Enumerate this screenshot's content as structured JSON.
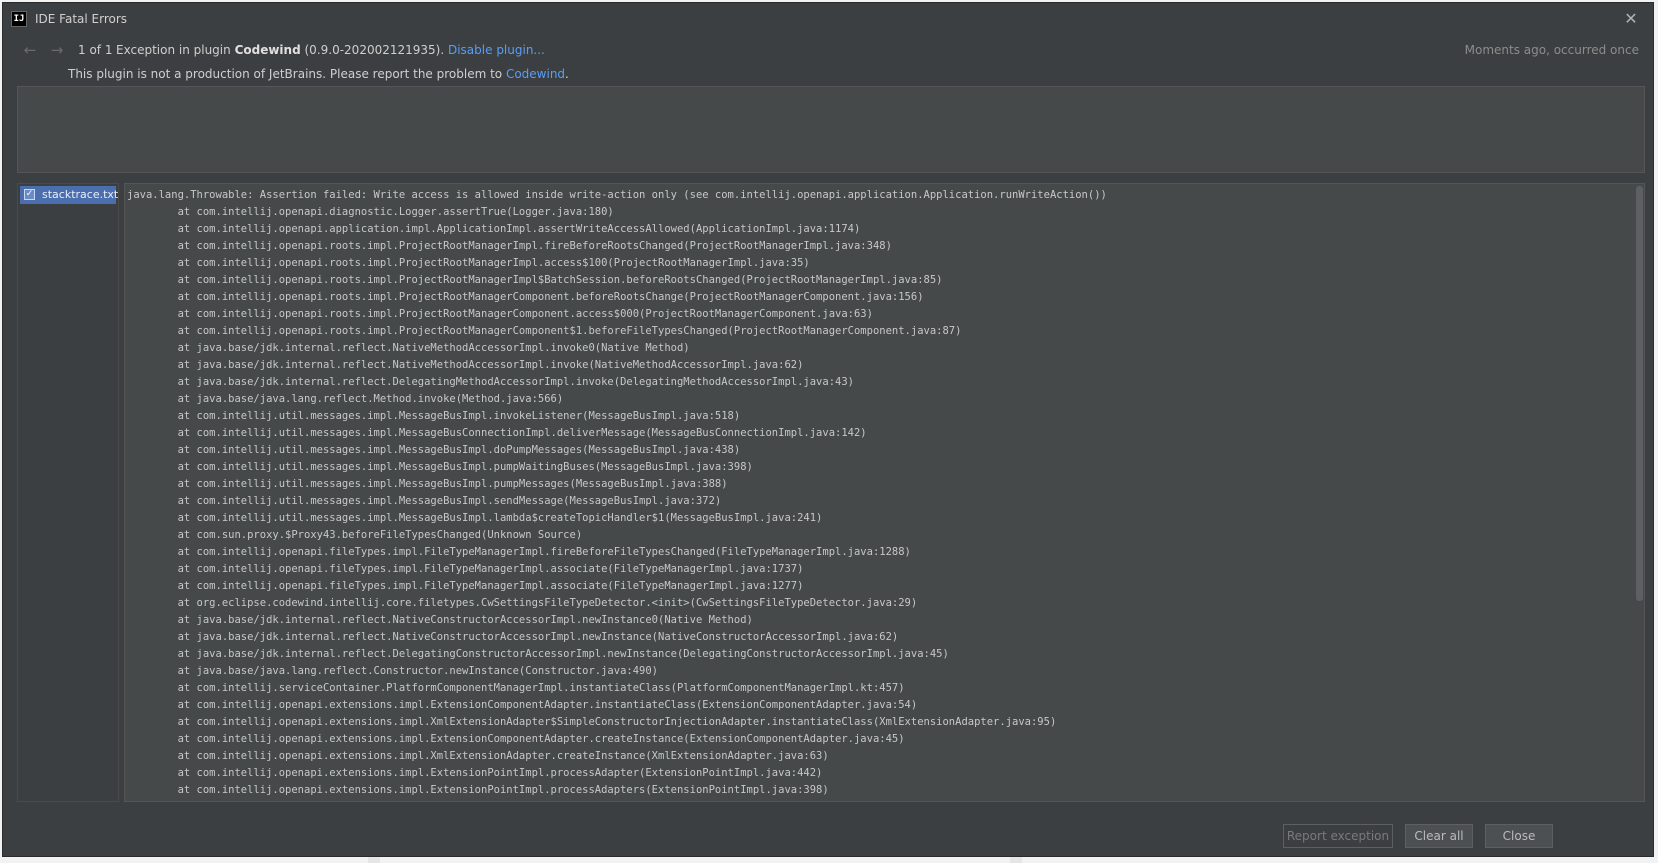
{
  "window": {
    "title": "IDE Fatal Errors",
    "logo_text": "IJ"
  },
  "header": {
    "counter": "1 of 1",
    "exception_prefix": "Exception in plugin ",
    "plugin_name": "Codewind",
    "plugin_version": " (0.9.0-202002121935). ",
    "disable_link": "Disable plugin...",
    "time_text": "Moments ago, occurred once"
  },
  "notice": {
    "text": "This plugin is not a production of JetBrains. Please report the problem to ",
    "link": "Codewind",
    "suffix": "."
  },
  "attachments": [
    {
      "name": "stacktrace.txt",
      "checked": true
    }
  ],
  "stacktrace": [
    "java.lang.Throwable: Assertion failed: Write access is allowed inside write-action only (see com.intellij.openapi.application.Application.runWriteAction())",
    "\tat com.intellij.openapi.diagnostic.Logger.assertTrue(Logger.java:180)",
    "\tat com.intellij.openapi.application.impl.ApplicationImpl.assertWriteAccessAllowed(ApplicationImpl.java:1174)",
    "\tat com.intellij.openapi.roots.impl.ProjectRootManagerImpl.fireBeforeRootsChanged(ProjectRootManagerImpl.java:348)",
    "\tat com.intellij.openapi.roots.impl.ProjectRootManagerImpl.access$100(ProjectRootManagerImpl.java:35)",
    "\tat com.intellij.openapi.roots.impl.ProjectRootManagerImpl$BatchSession.beforeRootsChanged(ProjectRootManagerImpl.java:85)",
    "\tat com.intellij.openapi.roots.impl.ProjectRootManagerComponent.beforeRootsChange(ProjectRootManagerComponent.java:156)",
    "\tat com.intellij.openapi.roots.impl.ProjectRootManagerComponent.access$000(ProjectRootManagerComponent.java:63)",
    "\tat com.intellij.openapi.roots.impl.ProjectRootManagerComponent$1.beforeFileTypesChanged(ProjectRootManagerComponent.java:87)",
    "\tat java.base/jdk.internal.reflect.NativeMethodAccessorImpl.invoke0(Native Method)",
    "\tat java.base/jdk.internal.reflect.NativeMethodAccessorImpl.invoke(NativeMethodAccessorImpl.java:62)",
    "\tat java.base/jdk.internal.reflect.DelegatingMethodAccessorImpl.invoke(DelegatingMethodAccessorImpl.java:43)",
    "\tat java.base/java.lang.reflect.Method.invoke(Method.java:566)",
    "\tat com.intellij.util.messages.impl.MessageBusImpl.invokeListener(MessageBusImpl.java:518)",
    "\tat com.intellij.util.messages.impl.MessageBusConnectionImpl.deliverMessage(MessageBusConnectionImpl.java:142)",
    "\tat com.intellij.util.messages.impl.MessageBusImpl.doPumpMessages(MessageBusImpl.java:438)",
    "\tat com.intellij.util.messages.impl.MessageBusImpl.pumpWaitingBuses(MessageBusImpl.java:398)",
    "\tat com.intellij.util.messages.impl.MessageBusImpl.pumpMessages(MessageBusImpl.java:388)",
    "\tat com.intellij.util.messages.impl.MessageBusImpl.sendMessage(MessageBusImpl.java:372)",
    "\tat com.intellij.util.messages.impl.MessageBusImpl.lambda$createTopicHandler$1(MessageBusImpl.java:241)",
    "\tat com.sun.proxy.$Proxy43.beforeFileTypesChanged(Unknown Source)",
    "\tat com.intellij.openapi.fileTypes.impl.FileTypeManagerImpl.fireBeforeFileTypesChanged(FileTypeManagerImpl.java:1288)",
    "\tat com.intellij.openapi.fileTypes.impl.FileTypeManagerImpl.associate(FileTypeManagerImpl.java:1737)",
    "\tat com.intellij.openapi.fileTypes.impl.FileTypeManagerImpl.associate(FileTypeManagerImpl.java:1277)",
    "\tat org.eclipse.codewind.intellij.core.filetypes.CwSettingsFileTypeDetector.<init>(CwSettingsFileTypeDetector.java:29)",
    "\tat java.base/jdk.internal.reflect.NativeConstructorAccessorImpl.newInstance0(Native Method)",
    "\tat java.base/jdk.internal.reflect.NativeConstructorAccessorImpl.newInstance(NativeConstructorAccessorImpl.java:62)",
    "\tat java.base/jdk.internal.reflect.DelegatingConstructorAccessorImpl.newInstance(DelegatingConstructorAccessorImpl.java:45)",
    "\tat java.base/java.lang.reflect.Constructor.newInstance(Constructor.java:490)",
    "\tat com.intellij.serviceContainer.PlatformComponentManagerImpl.instantiateClass(PlatformComponentManagerImpl.kt:457)",
    "\tat com.intellij.openapi.extensions.impl.ExtensionComponentAdapter.instantiateClass(ExtensionComponentAdapter.java:54)",
    "\tat com.intellij.openapi.extensions.impl.XmlExtensionAdapter$SimpleConstructorInjectionAdapter.instantiateClass(XmlExtensionAdapter.java:95)",
    "\tat com.intellij.openapi.extensions.impl.ExtensionComponentAdapter.createInstance(ExtensionComponentAdapter.java:45)",
    "\tat com.intellij.openapi.extensions.impl.XmlExtensionAdapter.createInstance(XmlExtensionAdapter.java:63)",
    "\tat com.intellij.openapi.extensions.impl.ExtensionPointImpl.processAdapter(ExtensionPointImpl.java:442)",
    "\tat com.intellij.openapi.extensions.impl.ExtensionPointImpl.processAdapters(ExtensionPointImpl.java:398)"
  ],
  "buttons": {
    "report": "Report exception",
    "clear_all": "Clear all",
    "close": "Close"
  },
  "colors": {
    "background": "#3c3f41",
    "panel": "#45494a",
    "link": "#589df6",
    "selection": "#4b6eaf"
  }
}
